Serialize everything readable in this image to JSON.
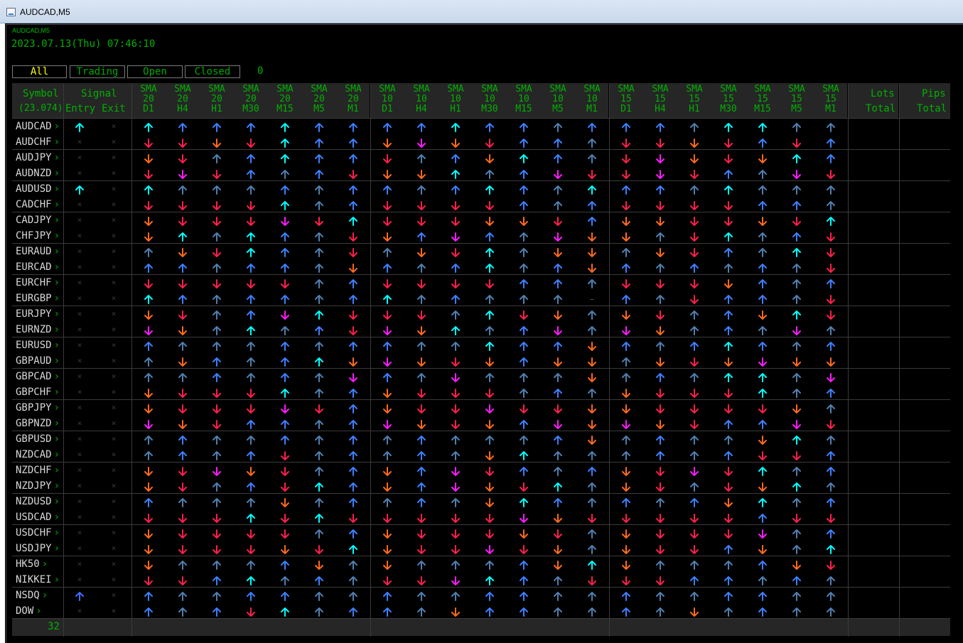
{
  "window": {
    "title": "AUDCAD,M5"
  },
  "chart": {
    "symbol_label": "AUDCAD,M5",
    "datetime": "2023.07.13(Thu) 07:46:10"
  },
  "filters": {
    "tabs": [
      {
        "label": "All",
        "active": true
      },
      {
        "label": "Trading",
        "active": false
      },
      {
        "label": "Open",
        "active": false
      },
      {
        "label": "Closed",
        "active": false
      }
    ],
    "count": "0"
  },
  "table": {
    "symbol_header": "Symbol",
    "symbol_sub": "(23.074)",
    "signal_header": "Signal",
    "entry_header": "Entry",
    "exit_header": "Exit",
    "lots_header": "Lots",
    "lots_sub": "Total",
    "pips_header": "Pips",
    "pips_sub": "Total",
    "sma_groups": [
      {
        "label": "SMA",
        "period": "20",
        "timeframes": [
          "D1",
          "H4",
          "H1",
          "M30",
          "M15",
          "M5",
          "M1"
        ]
      },
      {
        "label": "SMA",
        "period": "10",
        "timeframes": [
          "D1",
          "H4",
          "H1",
          "M30",
          "M15",
          "M5",
          "M1"
        ]
      },
      {
        "label": "SMA",
        "period": "15",
        "timeframes": [
          "D1",
          "H4",
          "H1",
          "M30",
          "M15",
          "M5",
          "M1"
        ]
      }
    ],
    "row_count": "32",
    "legend": {
      "u": "up strong (cyan)",
      "b": "up (blue)",
      "s": "up (steel)",
      "d": "down (orange)",
      "r": "down (red)",
      "m": "down strong (magenta)",
      "-": "flat"
    },
    "colors": {
      "u": "#00ffff",
      "b": "#3d7fff",
      "s": "#4f7fb0",
      "d": "#ff6a1a",
      "r": "#ff1f4b",
      "m": "#ff1aff",
      "signal": "#3d6fff",
      "grid_line": "#3a3a3a",
      "header_text": "#00b000"
    },
    "rows": [
      {
        "symbol": "AUDCAD",
        "entry": "u",
        "exit": "x",
        "sig": "uBbbubb bbuBbsb bbsuuss"
      },
      {
        "symbol": "AUDCHF",
        "entry": "x",
        "exit": "x",
        "sig": "rrdrubb dmdrbbs rrdrbrb"
      },
      {
        "symbol": "AUDJPY",
        "entry": "x",
        "exit": "x",
        "sig": "drsbubb rsbdubs rmdrdub"
      },
      {
        "symbol": "AUDNZD",
        "entry": "x",
        "exit": "x",
        "sig": "rmrbsbr ddusbmr rmrbsmr"
      },
      {
        "symbol": "AUDUSD",
        "entry": "u",
        "exit": "x",
        "sig": "usssbsb bsbubsu bbsusss"
      },
      {
        "symbol": "CADCHF",
        "entry": "x",
        "exit": "x",
        "sig": "rrrrusb rrrrbsb rrrrbbs"
      },
      {
        "symbol": "CADJPY",
        "entry": "x",
        "exit": "x",
        "sig": "drrrmru rrrddrb ddrrdru"
      },
      {
        "symbol": "CHFJPY",
        "entry": "x",
        "exit": "x",
        "sig": "dusubsr dbmbsmd dsrusbr"
      },
      {
        "symbol": "EURAUD",
        "entry": "x",
        "exit": "x",
        "sig": "sdrubsr sdrusdd sdrbsur"
      },
      {
        "symbol": "EURCAD",
        "entry": "x",
        "exit": "x",
        "sig": "bbsbbsd bsbusbd bsbsbsr"
      },
      {
        "symbol": "EURCHF",
        "entry": "x",
        "exit": "x",
        "sig": "rrrrrsb rrrrbbs rrrdbsb"
      },
      {
        "symbol": "EURGBP",
        "entry": "x",
        "exit": "x",
        "sig": "ubsbbsb usbsss- bsrbbsr"
      },
      {
        "symbol": "EURJPY",
        "entry": "x",
        "exit": "x",
        "sig": "drsbmur rrsurds drsbdur"
      },
      {
        "symbol": "EURNZD",
        "entry": "x",
        "exit": "x",
        "sig": "mdsusbr mdusbms mdsbsms"
      },
      {
        "symbol": "EURUSD",
        "entry": "x",
        "exit": "x",
        "sig": "bsssbsb bssubbd bsbubsb"
      },
      {
        "symbol": "GBPAUD",
        "entry": "x",
        "exit": "x",
        "sig": "sdbsbud mdrdbdd sdrdmdd"
      },
      {
        "symbol": "GBPCAD",
        "entry": "x",
        "exit": "x",
        "sig": "ssbsbsm bsmsssd sbsuusm"
      },
      {
        "symbol": "GBPCHF",
        "entry": "x",
        "exit": "x",
        "sig": "drrrusb drrrsbs drrrusb"
      },
      {
        "symbol": "GBPJPY",
        "entry": "x",
        "exit": "x",
        "sig": "drrrmrb drrmrrd drrrrds"
      },
      {
        "symbol": "GBPNZD",
        "entry": "x",
        "exit": "x",
        "sig": "mdrbbsb mdrdbmd mdrbbmr"
      },
      {
        "symbol": "GBPUSD",
        "entry": "x",
        "exit": "x",
        "sig": "sbssbsb sbsssbd sbssdus"
      },
      {
        "symbol": "NZDCAD",
        "entry": "x",
        "exit": "x",
        "sig": "sbsbrsb sbsduss sbsbrrb"
      },
      {
        "symbol": "NZDCHF",
        "entry": "x",
        "exit": "x",
        "sig": "drmdrsb dbmrbsb drmrusb"
      },
      {
        "symbol": "NZDJPY",
        "entry": "x",
        "exit": "x",
        "sig": "drsbrub dbmdrus drsrdus"
      },
      {
        "symbol": "NZDUSD",
        "entry": "x",
        "exit": "x",
        "sig": "bsssdsb sbsdubs bsbdusb"
      },
      {
        "symbol": "USDCAD",
        "entry": "x",
        "exit": "x",
        "sig": "rrrurur rrrrmdr rrrrbrr"
      },
      {
        "symbol": "USDCHF",
        "entry": "x",
        "exit": "x",
        "sig": "drrrrsb drrrdrs drrrmsb"
      },
      {
        "symbol": "USDJPY",
        "entry": "x",
        "exit": "x",
        "sig": "drrrdru drrmrds drrbdsu"
      },
      {
        "symbol": "HK50",
        "entry": "x",
        "exit": "x",
        "sig": "dsssbds dsssbdu dsssbdr"
      },
      {
        "symbol": "NIKKEI",
        "entry": "x",
        "exit": "x",
        "sig": "rrbusbs rrmubsr rrbbsbs"
      },
      {
        "symbol": "NSDQ",
        "entry": "b",
        "exit": "x",
        "sig": "bssbbss bssbbss bssbbss"
      },
      {
        "symbol": "DOW",
        "entry": "x",
        "exit": "x",
        "sig": "bsbrusb bsdbbss bsdsbss"
      }
    ]
  }
}
